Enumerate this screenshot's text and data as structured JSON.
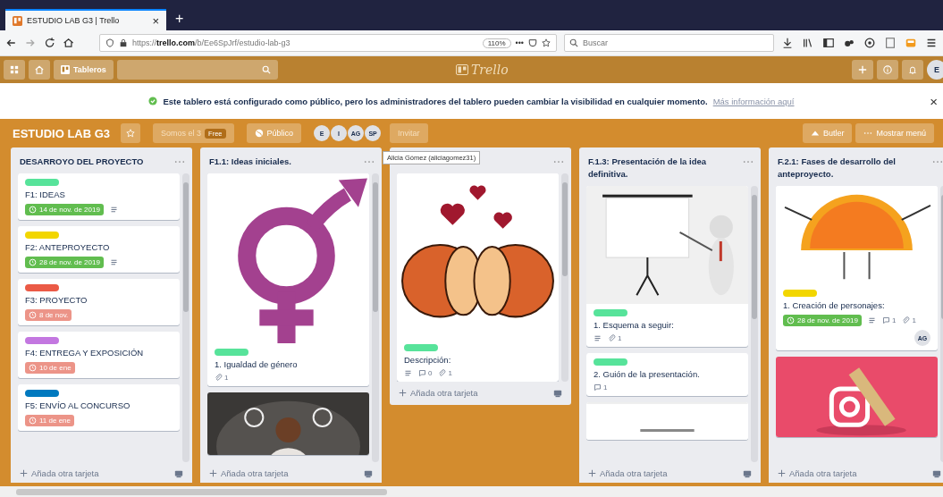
{
  "browser": {
    "tab": {
      "title": "ESTUDIO LAB G3 | Trello",
      "close": "×"
    },
    "new_tab": "+",
    "url": "https://**trello.com**/b/Ee6SpJrf/estudio-lab-g3",
    "zoom": "110%",
    "more": "•••",
    "search": {
      "placeholder": "Buscar"
    }
  },
  "header": {
    "boards": "Tableros",
    "logo": "Trello",
    "user": "E"
  },
  "banner": {
    "text": "Este tablero está configurado como público, pero los administradores del tablero pueden cambiar la visibilidad en cualquier momento.",
    "link": "Más información aquí",
    "close": "×"
  },
  "board": {
    "title": "ESTUDIO LAB G3",
    "team": "Somos el 3",
    "team_badge": "Free",
    "visibility": "Público",
    "members": [
      {
        "initials": "E"
      },
      {
        "initials": "I"
      },
      {
        "initials": "AG"
      },
      {
        "initials": "SP"
      }
    ],
    "invite": "Invitar",
    "butler": "Butler",
    "menu": "Mostrar menú"
  },
  "tooltip": "Alicia Gómez (aliciagomez31)",
  "lists": [
    {
      "title": "DESARROYO DEL PROYECTO",
      "add_card": "Añada otra tarjeta",
      "cards": [
        {
          "labels": [
            {
              "color": "#57e39a"
            }
          ],
          "title": "F1: IDEAS",
          "due": {
            "text": "14 de nov. de 2019",
            "complete": true
          },
          "description": true
        },
        {
          "labels": [
            {
              "color": "#f2d600"
            }
          ],
          "title": "F2: ANTEPROYECTO",
          "due": {
            "text": "28 de nov. de 2019",
            "complete": true
          },
          "description": true
        },
        {
          "labels": [
            {
              "color": "#eb5a46"
            }
          ],
          "title": "F3: PROYECTO",
          "due": {
            "text": "8 de nov.",
            "complete": false
          }
        },
        {
          "labels": [
            {
              "color": "#c377e0"
            }
          ],
          "title": "F4: ENTREGA Y EXPOSICIÓN",
          "due": {
            "text": "10 de ene",
            "complete": false
          }
        },
        {
          "labels": [
            {
              "color": "#0079bf"
            }
          ],
          "title": "F5: ENVÍO AL CONCURSO",
          "due": {
            "text": "11 de ene",
            "complete": false
          }
        }
      ]
    },
    {
      "title": "F1.1: Ideas iniciales.",
      "add_card": "Añada otra tarjeta",
      "cards": [
        {
          "cover": {
            "kind": "picture"
          },
          "labels": [
            {
              "color": "#57e39a"
            }
          ],
          "title": "1. Igualdad de género",
          "attachments": "1"
        },
        {
          "cover": {
            "kind": "picture"
          }
        }
      ]
    },
    {
      "add_card": "Añada otra tarjeta",
      "cards": [
        {
          "cover": {
            "kind": "picture"
          },
          "labels": [
            {
              "color": "#57e39a"
            }
          ],
          "title": "Descripción:",
          "description": true,
          "comments": "0",
          "attachments": "1"
        }
      ]
    },
    {
      "title": "F.1.3: Presentación de la idea definitiva.",
      "add_card": "Añada otra tarjeta",
      "cards": [
        {
          "cover": {
            "kind": "picture"
          },
          "labels": [
            {
              "color": "#57e39a"
            }
          ],
          "title": "1. Esquema a seguir:",
          "description": true,
          "attachments": "1"
        },
        {
          "labels": [
            {
              "color": "#57e39a"
            }
          ],
          "title": "2. Guión de la presentación.",
          "comments": "1"
        },
        {
          "cover": {
            "kind": "picture"
          }
        }
      ]
    },
    {
      "title": "F.2.1: Fases de desarrollo del anteproyecto.",
      "add_card": "Añada otra tarjeta",
      "cards": [
        {
          "cover": {
            "kind": "picture"
          },
          "labels": [
            {
              "color": "#f2d600"
            }
          ],
          "title": "1. Creación de personajes:",
          "due": {
            "text": "28 de nov. de 2019",
            "complete": true
          },
          "description": true,
          "comments": "1",
          "attachments": "1",
          "members": [
            "AG"
          ]
        },
        {
          "cover": {
            "kind": "picture"
          }
        }
      ]
    }
  ]
}
